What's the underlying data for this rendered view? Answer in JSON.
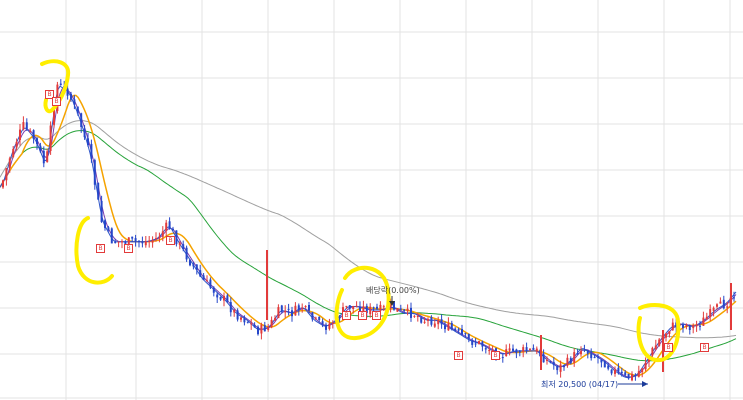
{
  "chart_data": {
    "type": "candlestick",
    "grid": true,
    "legend": "none",
    "moving_averages": [
      {
        "color": "#f5a300",
        "role": "short"
      },
      {
        "color": "#7b3fb0",
        "role": "very-short"
      },
      {
        "color": "#2e55c9",
        "role": "very-short-2"
      },
      {
        "color": "#27a33a",
        "role": "medium"
      },
      {
        "color": "#a0a0a0",
        "role": "long"
      }
    ],
    "close_trend": [
      60,
      71,
      78,
      74,
      66,
      90,
      88,
      80,
      69,
      50,
      44,
      44,
      44,
      44,
      45,
      49,
      43,
      38,
      33,
      30,
      27,
      23,
      21,
      18,
      19,
      24,
      23,
      25,
      21,
      19,
      21,
      25,
      25,
      24,
      24,
      25,
      23,
      23,
      21,
      21,
      19,
      17,
      15,
      14,
      12,
      11,
      12,
      12,
      12,
      9,
      7,
      9,
      13,
      11,
      9,
      6,
      4,
      5,
      10,
      15,
      19,
      20,
      19,
      21,
      24,
      26,
      30
    ],
    "colors": {
      "up": "#e23b3b",
      "down": "#2546c9",
      "highlight": "#ffee00",
      "grid": "#e3e3e3",
      "low_arrow": "#1b3b9a"
    }
  },
  "annotations": {
    "dividend": "배당락(0.00%)",
    "low": "최저 20,500 (04/17)"
  },
  "badges": {
    "symbol": "B"
  }
}
